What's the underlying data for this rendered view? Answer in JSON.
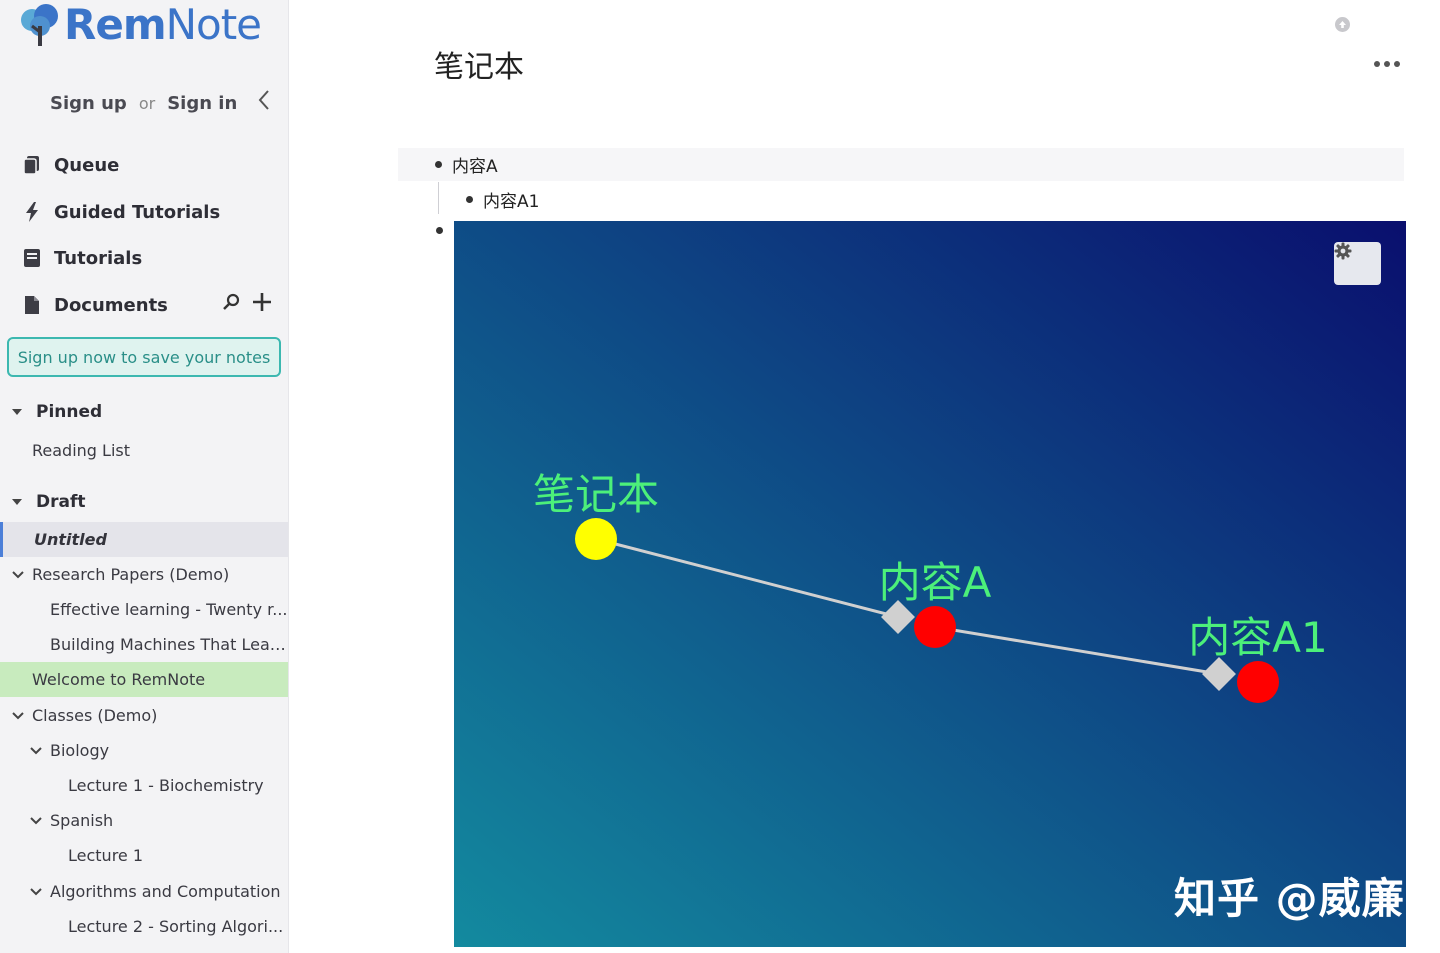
{
  "brand": {
    "part1": "Rem",
    "part2": "Note"
  },
  "auth": {
    "signup": "Sign up",
    "or": "or",
    "signin": "Sign in"
  },
  "nav": {
    "queue": "Queue",
    "guided": "Guided Tutorials",
    "tutorials": "Tutorials",
    "documents": "Documents"
  },
  "signup_banner": "Sign up now to save your notes",
  "pinned": {
    "title": "Pinned",
    "items": [
      "Reading List"
    ]
  },
  "draft": {
    "title": "Draft"
  },
  "tree": [
    {
      "label": "Untitled"
    },
    {
      "label": "Research Papers (Demo)"
    },
    {
      "label": "Effective learning - Twenty r..."
    },
    {
      "label": "Building Machines That Lear..."
    },
    {
      "label": "Welcome to RemNote"
    },
    {
      "label": "Classes (Demo)"
    },
    {
      "label": "Biology"
    },
    {
      "label": "Lecture 1 - Biochemistry"
    },
    {
      "label": "Spanish"
    },
    {
      "label": "Lecture 1"
    },
    {
      "label": "Algorithms and Computation"
    },
    {
      "label": "Lecture 2 - Sorting Algori..."
    }
  ],
  "page": {
    "title": "笔记本",
    "rems": [
      {
        "text": "内容A"
      },
      {
        "text": "内容A1"
      }
    ]
  },
  "graph": {
    "nodes": [
      {
        "label": "笔记本",
        "color": "#ffff00"
      },
      {
        "label": "内容A",
        "color": "#ff0000"
      },
      {
        "label": "内容A1",
        "color": "#ff0000"
      }
    ],
    "label_color": "#4cf07a",
    "edge_color": "#d0d0d0",
    "gradient_start": "#138a9f",
    "gradient_end": "#0a0f6e"
  },
  "watermark": "知乎 @威廉",
  "colors": {
    "accent": "#3b74c8",
    "highlight": "#c8ebbe",
    "banner_border": "#3cb8b0"
  }
}
